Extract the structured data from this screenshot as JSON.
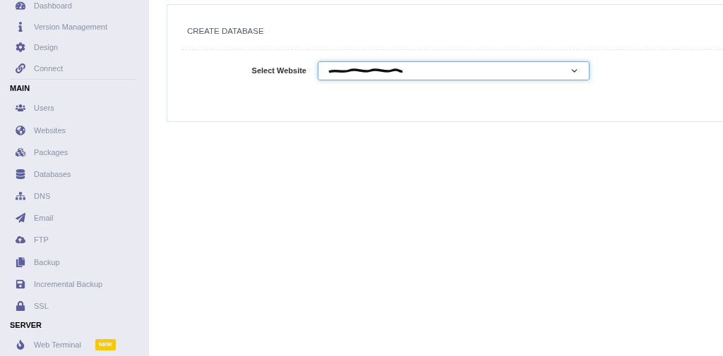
{
  "sidebar": {
    "items": [
      {
        "kind": "item",
        "label": "Dashboard"
      },
      {
        "kind": "item",
        "label": "Version Management"
      },
      {
        "kind": "item",
        "label": "Design"
      },
      {
        "kind": "item",
        "label": "Connect"
      },
      {
        "kind": "header",
        "label": "MAIN"
      },
      {
        "kind": "item",
        "label": "Users"
      },
      {
        "kind": "item",
        "label": "Websites"
      },
      {
        "kind": "item",
        "label": "Packages"
      },
      {
        "kind": "item",
        "label": "Databases"
      },
      {
        "kind": "item",
        "label": "DNS"
      },
      {
        "kind": "item",
        "label": "Email"
      },
      {
        "kind": "item",
        "label": "FTP"
      },
      {
        "kind": "item",
        "label": "Backup"
      },
      {
        "kind": "item",
        "label": "Incremental Backup"
      },
      {
        "kind": "item",
        "label": "SSL"
      },
      {
        "kind": "header",
        "label": "SERVER"
      },
      {
        "kind": "item",
        "label": "Web Terminal",
        "badge": "NEW"
      }
    ]
  },
  "card": {
    "title": "CREATE DATABASE",
    "form": {
      "label": "Select Website",
      "redacted": true
    }
  }
}
